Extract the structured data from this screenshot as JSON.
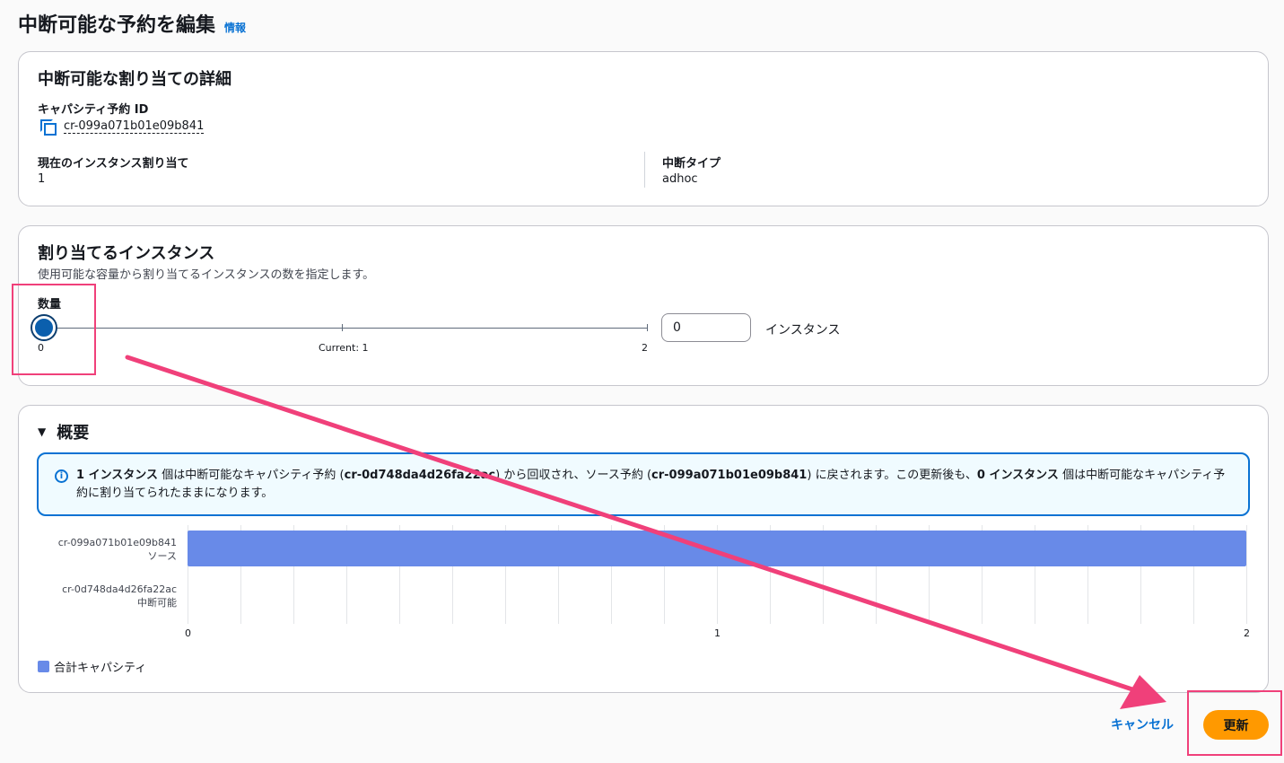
{
  "header": {
    "title": "中断可能な予約を編集",
    "info_link": "情報"
  },
  "details": {
    "title": "中断可能な割り当ての詳細",
    "reservation_id_label": "キャパシティ予約 ID",
    "reservation_id": "cr-099a071b01e09b841",
    "current_alloc_label": "現在のインスタンス割り当て",
    "current_alloc_value": "1",
    "interrupt_type_label": "中断タイプ",
    "interrupt_type_value": "adhoc"
  },
  "allocation": {
    "title": "割り当てるインスタンス",
    "description": "使用可能な容量から割り当てるインスタンスの数を指定します。",
    "quantity_label": "数量",
    "slider_min": 0,
    "slider_max": 2,
    "slider_value": 0,
    "tick_min_label": "0",
    "tick_current_label": "Current: 1",
    "tick_max_label": "2",
    "input_value": "0",
    "unit_label": "インスタンス"
  },
  "summary": {
    "title": "概要",
    "alert": {
      "b1": "1 インスタンス",
      "t1": " 個は中断可能なキャパシティ予約 (",
      "b2": "cr-0d748da4d26fa22ac",
      "t2": ") から回収され、ソース予約 (",
      "b3": "cr-099a071b01e09b841",
      "t3": ") に戻されます。この更新後も、",
      "b4": "0 インスタンス",
      "t4": " 個は中断可能なキャパシティ予約に割り当てられたままになります。"
    }
  },
  "chart_data": {
    "type": "bar",
    "orientation": "horizontal",
    "categories": [
      {
        "id": "cr-099a071b01e09b841",
        "sub": "ソース"
      },
      {
        "id": "cr-0d748da4d26fa22ac",
        "sub": "中断可能"
      }
    ],
    "series": [
      {
        "name": "合計キャパシティ",
        "values": [
          2,
          0
        ]
      }
    ],
    "xlim": [
      0,
      2
    ],
    "x_ticks": [
      "0",
      "1",
      "2"
    ],
    "grid": true,
    "legend": "bottom-left",
    "color": "#688ae8"
  },
  "footer": {
    "cancel_label": "キャンセル",
    "update_label": "更新"
  },
  "colors": {
    "accent": "#0972d3",
    "primary_button": "#ff9900",
    "annotation": "#f0407a"
  }
}
